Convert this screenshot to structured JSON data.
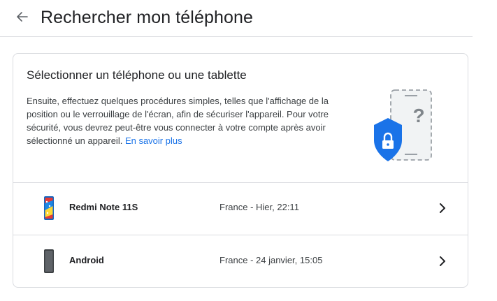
{
  "header": {
    "title": "Rechercher mon téléphone"
  },
  "card": {
    "title": "Sélectionner un téléphone ou une tablette",
    "description": "Ensuite, effectuez quelques procédures simples, telles que l'affichage de la position ou le verrouillage de l'écran, afin de sécuriser l'appareil. Pour votre sécurité, vous devrez peut-être vous connecter à votre compte après avoir sélectionné un appareil.",
    "learn_more": "En savoir plus"
  },
  "devices": [
    {
      "name": "Redmi Note 11S",
      "info": "France - Hier, 22:11",
      "icon": "colorful-phone-icon"
    },
    {
      "name": "Android",
      "info": "France - 24 janvier, 15:05",
      "icon": "dark-phone-icon"
    }
  ],
  "colors": {
    "accent": "#1a73e8",
    "shield": "#1a73e8",
    "border": "#dadce0"
  }
}
